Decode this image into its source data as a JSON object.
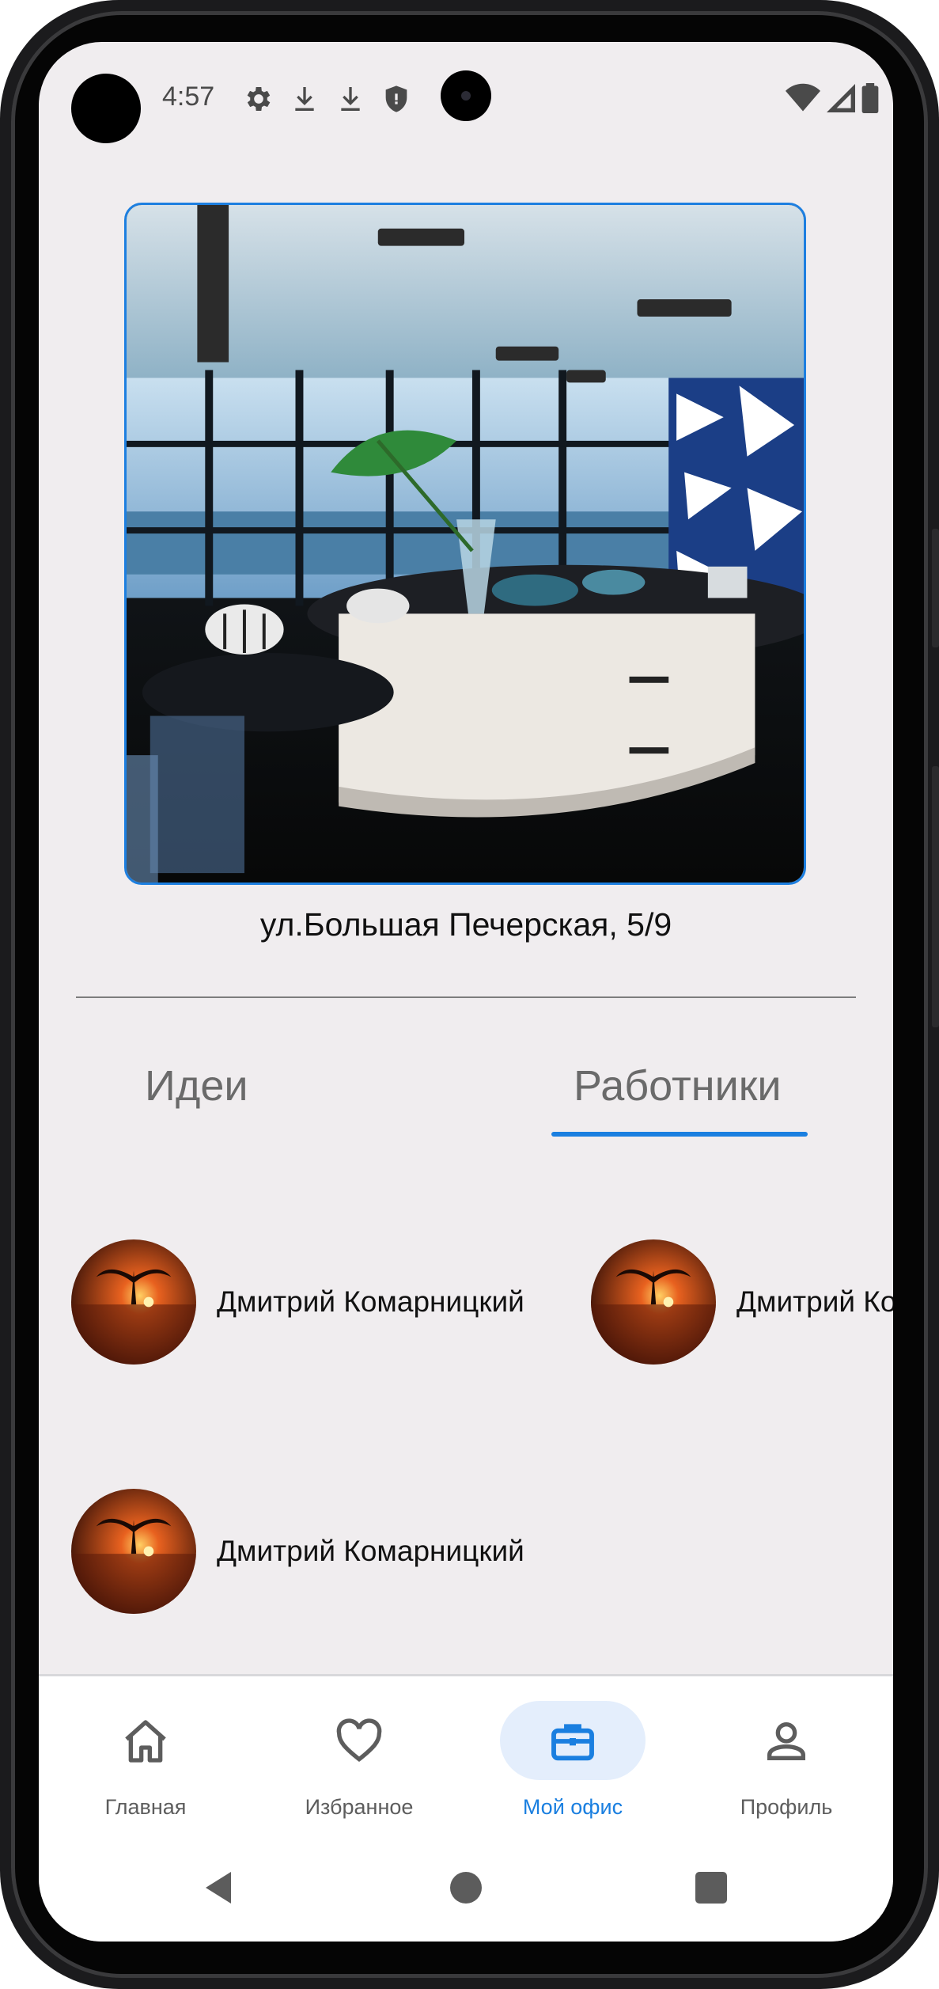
{
  "status_bar": {
    "time": "4:57"
  },
  "office": {
    "address": "ул.Большая Печерская, 5/9"
  },
  "tabs": [
    {
      "label": "Идеи",
      "selected": false
    },
    {
      "label": "Работники",
      "selected": true
    }
  ],
  "employees": [
    {
      "name": "Дмитрий Комарницкий"
    },
    {
      "name": "Дмитрий Комарницкий"
    },
    {
      "name": "Дмитрий Комарницкий"
    }
  ],
  "bottom_nav": [
    {
      "label": "Главная",
      "icon": "home-icon"
    },
    {
      "label": "Избранное",
      "icon": "heart-icon"
    },
    {
      "label": "Мой офис",
      "icon": "briefcase-icon",
      "active": true
    },
    {
      "label": "Профиль",
      "icon": "person-icon"
    }
  ],
  "colors": {
    "accent": "#1a7fe0",
    "background": "#f0edef",
    "active_pill": "#e4eefc"
  }
}
